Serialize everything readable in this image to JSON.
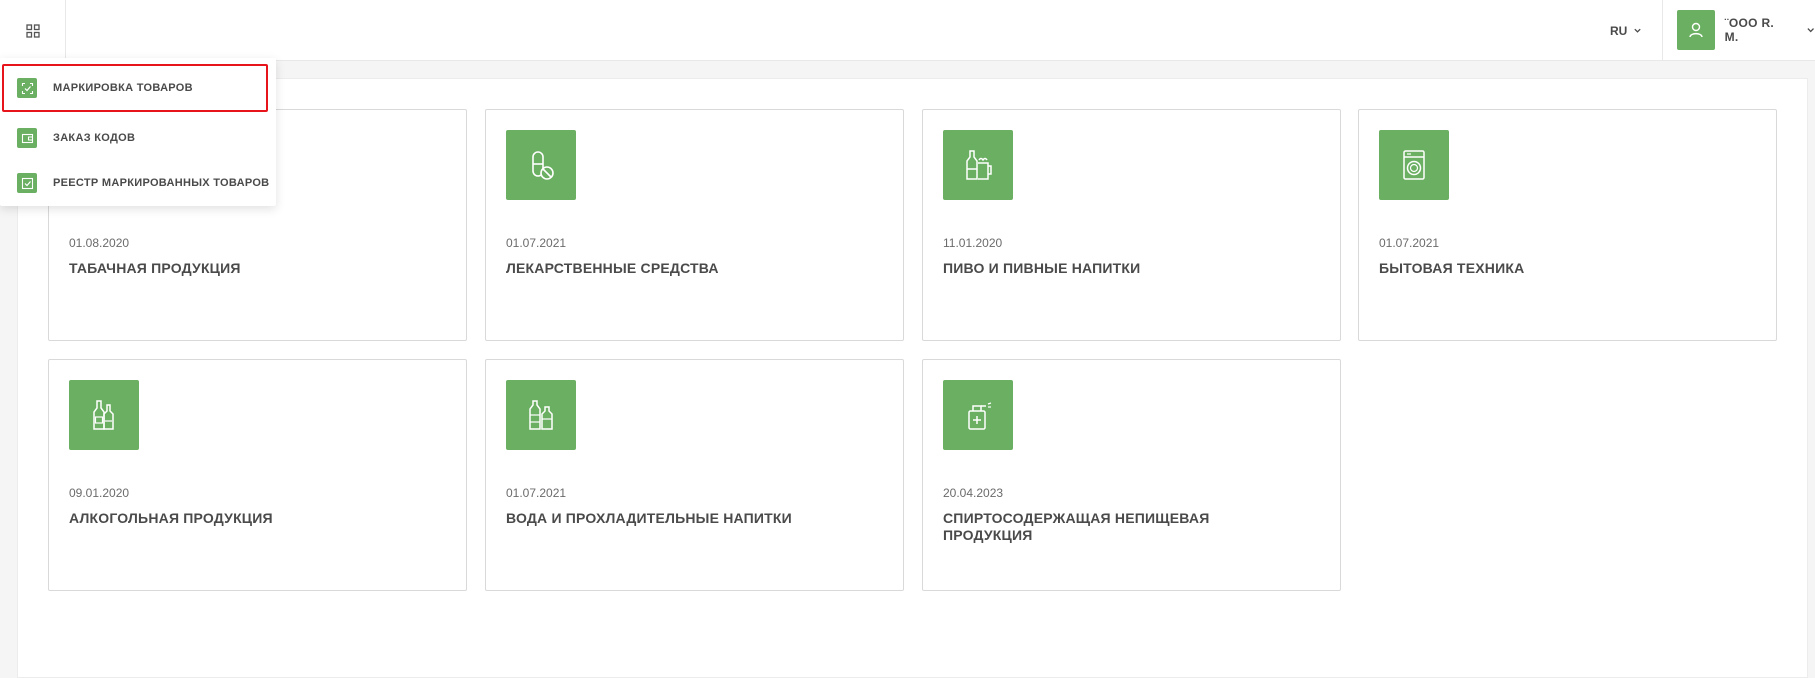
{
  "header": {
    "lang": "RU",
    "user_name": "¨OOO R. M."
  },
  "menu": {
    "items": [
      {
        "label": "МАРКИРОВКА ТОВАРОВ",
        "icon": "marking-icon",
        "active": true
      },
      {
        "label": "ЗАКАЗ КОДОВ",
        "icon": "wallet-icon",
        "active": false
      },
      {
        "label": "РЕЕСТР МАРКИРОВАННЫХ ТОВАРОВ",
        "icon": "checkbox-icon",
        "active": false
      }
    ]
  },
  "cards": [
    {
      "date": "01.08.2020",
      "title": "ТАБАЧНАЯ ПРОДУКЦИЯ",
      "icon": "tobacco-icon"
    },
    {
      "date": "01.07.2021",
      "title": "ЛЕКАРСТВЕННЫЕ СРЕДСТВА",
      "icon": "pill-icon"
    },
    {
      "date": "11.01.2020",
      "title": "ПИВО И ПИВНЫЕ НАПИТКИ",
      "icon": "beer-icon"
    },
    {
      "date": "01.07.2021",
      "title": "БЫТОВАЯ ТЕХНИКА",
      "icon": "washing-machine-icon"
    },
    {
      "date": "09.01.2020",
      "title": "АЛКОГОЛЬНАЯ ПРОДУКЦИЯ",
      "icon": "bottles-icon"
    },
    {
      "date": "01.07.2021",
      "title": "ВОДА И ПРОХЛАДИТЕЛЬНЫЕ НАПИТКИ",
      "icon": "water-icon"
    },
    {
      "date": "20.04.2023",
      "title": "СПИРТОСОДЕРЖАЩАЯ НЕПИЩЕВАЯ ПРОДУКЦИЯ",
      "icon": "sanitizer-icon"
    }
  ],
  "colors": {
    "accent": "#6aaf62",
    "highlight": "#e8141c"
  }
}
